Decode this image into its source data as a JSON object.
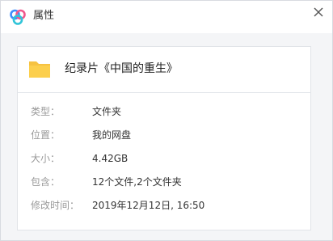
{
  "window": {
    "title": "属性",
    "logo_icon": "baidu-netdisk-logo",
    "close_icon": "close-x"
  },
  "file": {
    "icon": "folder-icon",
    "icon_color": "#F6C242",
    "name": "纪录片《中国的重生》"
  },
  "properties": {
    "type_label": "类型：",
    "type_value": "文件夹",
    "location_label": "位置：",
    "location_value": "我的网盘",
    "size_label": "大小：",
    "size_value": "4.42GB",
    "contains_label": "包含：",
    "contains_value": "12个文件,2个文件夹",
    "modified_label": "修改时间：",
    "modified_value": "2019年12月12日, 16:50"
  },
  "colors": {
    "logo_blue": "#3F8DFB",
    "logo_pink": "#F0588C",
    "logo_teal": "#30C4D8",
    "content_bg": "#f4f5f7"
  }
}
